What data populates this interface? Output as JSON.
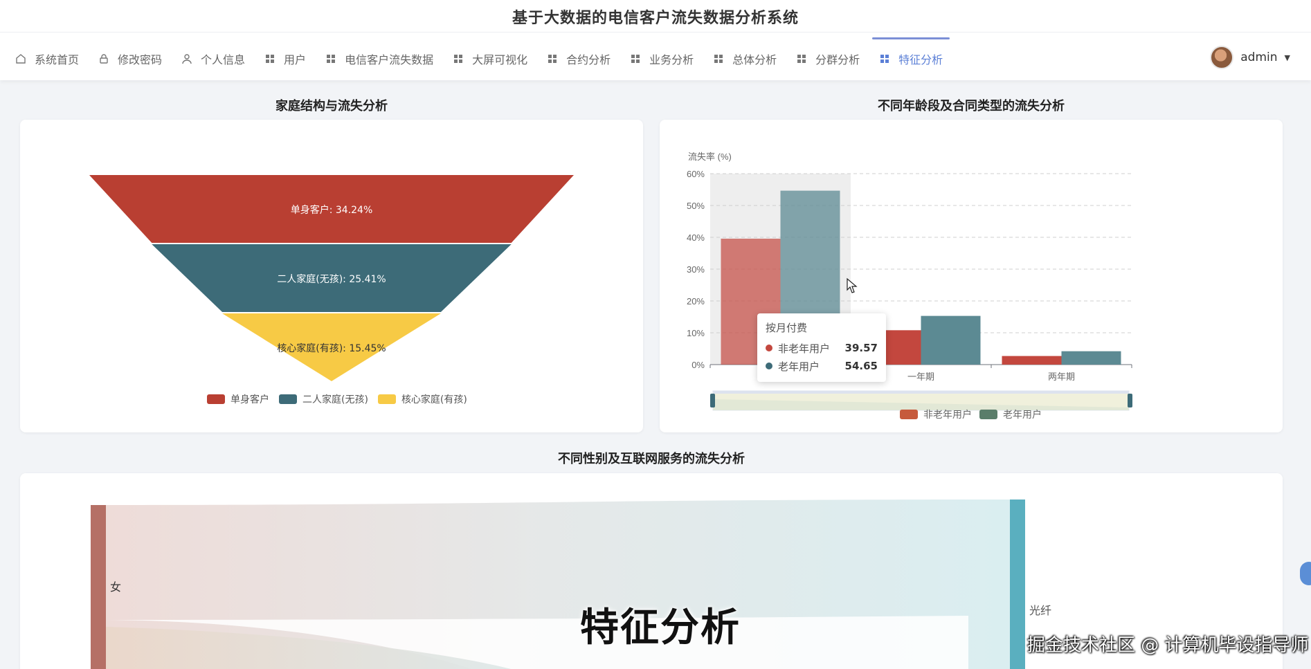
{
  "app": {
    "title": "基于大数据的电信客户流失数据分析系统"
  },
  "nav": [
    {
      "label": "系统首页",
      "icon": "home-icon"
    },
    {
      "label": "修改密码",
      "icon": "lock-icon"
    },
    {
      "label": "个人信息",
      "icon": "user-icon"
    },
    {
      "label": "用户",
      "icon": "grid-icon"
    },
    {
      "label": "电信客户流失数据",
      "icon": "grid-icon"
    },
    {
      "label": "大屏可视化",
      "icon": "grid-icon"
    },
    {
      "label": "合约分析",
      "icon": "grid-icon"
    },
    {
      "label": "业务分析",
      "icon": "grid-icon"
    },
    {
      "label": "总体分析",
      "icon": "grid-icon"
    },
    {
      "label": "分群分析",
      "icon": "grid-icon"
    },
    {
      "label": "特征分析",
      "icon": "grid-icon",
      "active": true
    }
  ],
  "user": {
    "name": "admin"
  },
  "sections": {
    "family": "家庭结构与流失分析",
    "age_contract": "不同年龄段及合同类型的流失分析",
    "gender_internet": "不同性别及互联网服务的流失分析"
  },
  "colors": {
    "single": "#b93f32",
    "couple": "#3d6b78",
    "nuclear": "#f7ca45",
    "non_senior": "#c3473e",
    "senior": "#5c8a93",
    "sankey_female": "#b57066",
    "sankey_fiber": "#5aafbf",
    "accent": "#5b7fd6"
  },
  "chart_data": [
    {
      "type": "funnel",
      "slices": [
        {
          "name": "单身客户",
          "value": 34.24,
          "label": "单身客户: 34.24%"
        },
        {
          "name": "二人家庭(无孩)",
          "value": 25.41,
          "label": "二人家庭(无孩): 25.41%"
        },
        {
          "name": "核心家庭(有孩)",
          "value": 15.45,
          "label": "核心家庭(有孩): 15.45%"
        }
      ],
      "legend": [
        "单身客户",
        "二人家庭(无孩)",
        "核心家庭(有孩)"
      ],
      "legend_position": "bottom"
    },
    {
      "type": "bar",
      "ylabel": "流失率 (%)",
      "ylim": [
        0,
        60
      ],
      "yticks": [
        "0%",
        "10%",
        "20%",
        "30%",
        "40%",
        "50%",
        "60%"
      ],
      "categories": [
        "按月付费",
        "一年期",
        "两年期"
      ],
      "category_labels": [
        "",
        "一年期",
        "两年期"
      ],
      "series": [
        {
          "name": "非老年用户",
          "values": [
            39.57,
            10.8,
            2.7
          ]
        },
        {
          "name": "老年用户",
          "values": [
            54.65,
            15.3,
            4.2
          ]
        }
      ],
      "legend_position": "bottom",
      "grid": true,
      "tooltip": {
        "title": "按月付费",
        "rows": [
          {
            "name": "非老年用户",
            "value": "39.57"
          },
          {
            "name": "老年用户",
            "value": "54.65"
          }
        ]
      }
    },
    {
      "type": "sankey",
      "nodes": [
        {
          "name": "女"
        },
        {
          "name": "光纤"
        }
      ]
    }
  ],
  "overlay": {
    "caption": "特征分析",
    "credit": "掘金技术社区 @ 计算机毕设指导师"
  }
}
